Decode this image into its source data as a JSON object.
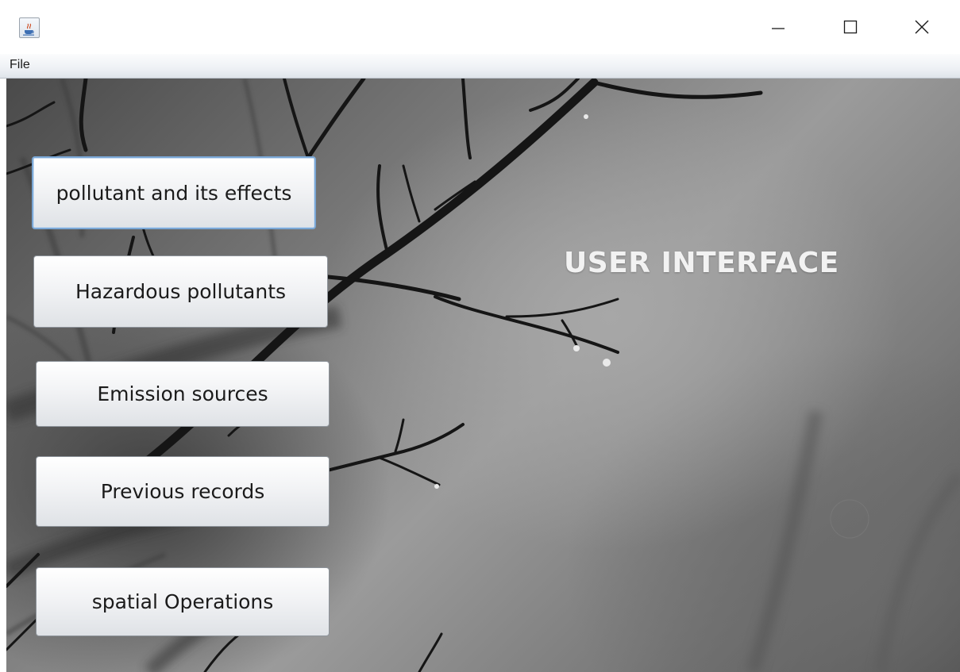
{
  "window": {
    "app_icon": "java-cup-icon",
    "controls": {
      "minimize_icon": "minimize-icon",
      "maximize_icon": "maximize-icon",
      "close_icon": "close-icon"
    }
  },
  "menubar": {
    "items": [
      {
        "label": "File"
      }
    ]
  },
  "main": {
    "heading": "USER INTERFACE",
    "buttons": [
      {
        "label": "pollutant and its effects",
        "focused": true
      },
      {
        "label": "Hazardous pollutants"
      },
      {
        "label": "Emission sources"
      },
      {
        "label": "Previous records"
      },
      {
        "label": "spatial Operations"
      }
    ]
  },
  "colors": {
    "heading_text": "#f2f2f2",
    "button_border": "#8e949b",
    "focus_ring": "#7aa7d6",
    "menubar_bg": "#eef1f5"
  }
}
